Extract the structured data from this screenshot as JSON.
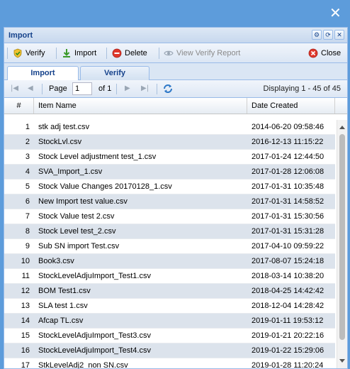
{
  "window": {
    "close_glyph": "✕"
  },
  "panel": {
    "title": "Import",
    "tools": [
      "⚙",
      "⟳",
      "✕"
    ]
  },
  "toolbar": {
    "verify_label": "Verify",
    "import_label": "Import",
    "delete_label": "Delete",
    "view_report_label": "View Verify Report",
    "close_label": "Close"
  },
  "tabs": [
    {
      "label": "Import",
      "active": true
    },
    {
      "label": "Verify",
      "active": false
    }
  ],
  "pager": {
    "page_label": "Page",
    "page_value": "1",
    "of_label": "of 1",
    "displaying": "Displaying 1 - 45 of 45"
  },
  "columns": {
    "num": "#",
    "name": "Item Name",
    "date": "Date Created"
  },
  "rows": [
    {
      "num": "1",
      "name": "stk adj test.csv",
      "date": "2014-06-20 09:58:46"
    },
    {
      "num": "2",
      "name": "StockLvl.csv",
      "date": "2016-12-13 11:15:22"
    },
    {
      "num": "3",
      "name": "Stock Level adjustment test_1.csv",
      "date": "2017-01-24 12:44:50"
    },
    {
      "num": "4",
      "name": "SVA_Import_1.csv",
      "date": "2017-01-28 12:06:08"
    },
    {
      "num": "5",
      "name": "Stock Value Changes 20170128_1.csv",
      "date": "2017-01-31 10:35:48"
    },
    {
      "num": "6",
      "name": "New Import test value.csv",
      "date": "2017-01-31 14:58:52"
    },
    {
      "num": "7",
      "name": "Stock Value test 2.csv",
      "date": "2017-01-31 15:30:56"
    },
    {
      "num": "8",
      "name": "Stock Level test_2.csv",
      "date": "2017-01-31 15:31:28"
    },
    {
      "num": "9",
      "name": "Sub SN import Test.csv",
      "date": "2017-04-10 09:59:22"
    },
    {
      "num": "10",
      "name": "Book3.csv",
      "date": "2017-08-07 15:24:18"
    },
    {
      "num": "11",
      "name": "StockLevelAdjuImport_Test1.csv",
      "date": "2018-03-14 10:38:20"
    },
    {
      "num": "12",
      "name": "BOM Test1.csv",
      "date": "2018-04-25 14:42:42"
    },
    {
      "num": "13",
      "name": "SLA test 1.csv",
      "date": "2018-12-04 14:28:42"
    },
    {
      "num": "14",
      "name": "Afcap TL.csv",
      "date": "2019-01-11 19:53:12"
    },
    {
      "num": "15",
      "name": "StockLevelAdjuImport_Test3.csv",
      "date": "2019-01-21 20:22:16"
    },
    {
      "num": "16",
      "name": "StockLevelAdjuImport_Test4.csv",
      "date": "2019-01-22 15:29:06"
    },
    {
      "num": "17",
      "name": "StkLevelAdj2_non SN.csv",
      "date": "2019-01-28 11:20:24"
    }
  ]
}
